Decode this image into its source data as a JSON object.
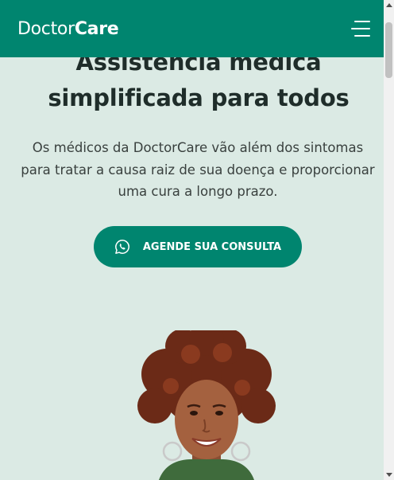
{
  "header": {
    "logo_prefix": "Doctor",
    "logo_suffix": "Care",
    "menu_icon": "hamburger-menu-icon"
  },
  "hero": {
    "title": "Assistência médica simplificada para todos",
    "description": "Os médicos da DoctorCare vão além dos sintomas para tratar a causa raiz de sua doença e proporcionar uma cura a longo prazo.",
    "cta_label": "AGENDE SUA CONSULTA",
    "cta_icon": "whatsapp-icon"
  },
  "colors": {
    "brand": "#00856f",
    "background": "#dbeae4",
    "heading": "#1f2d2a",
    "text": "#39403e"
  }
}
